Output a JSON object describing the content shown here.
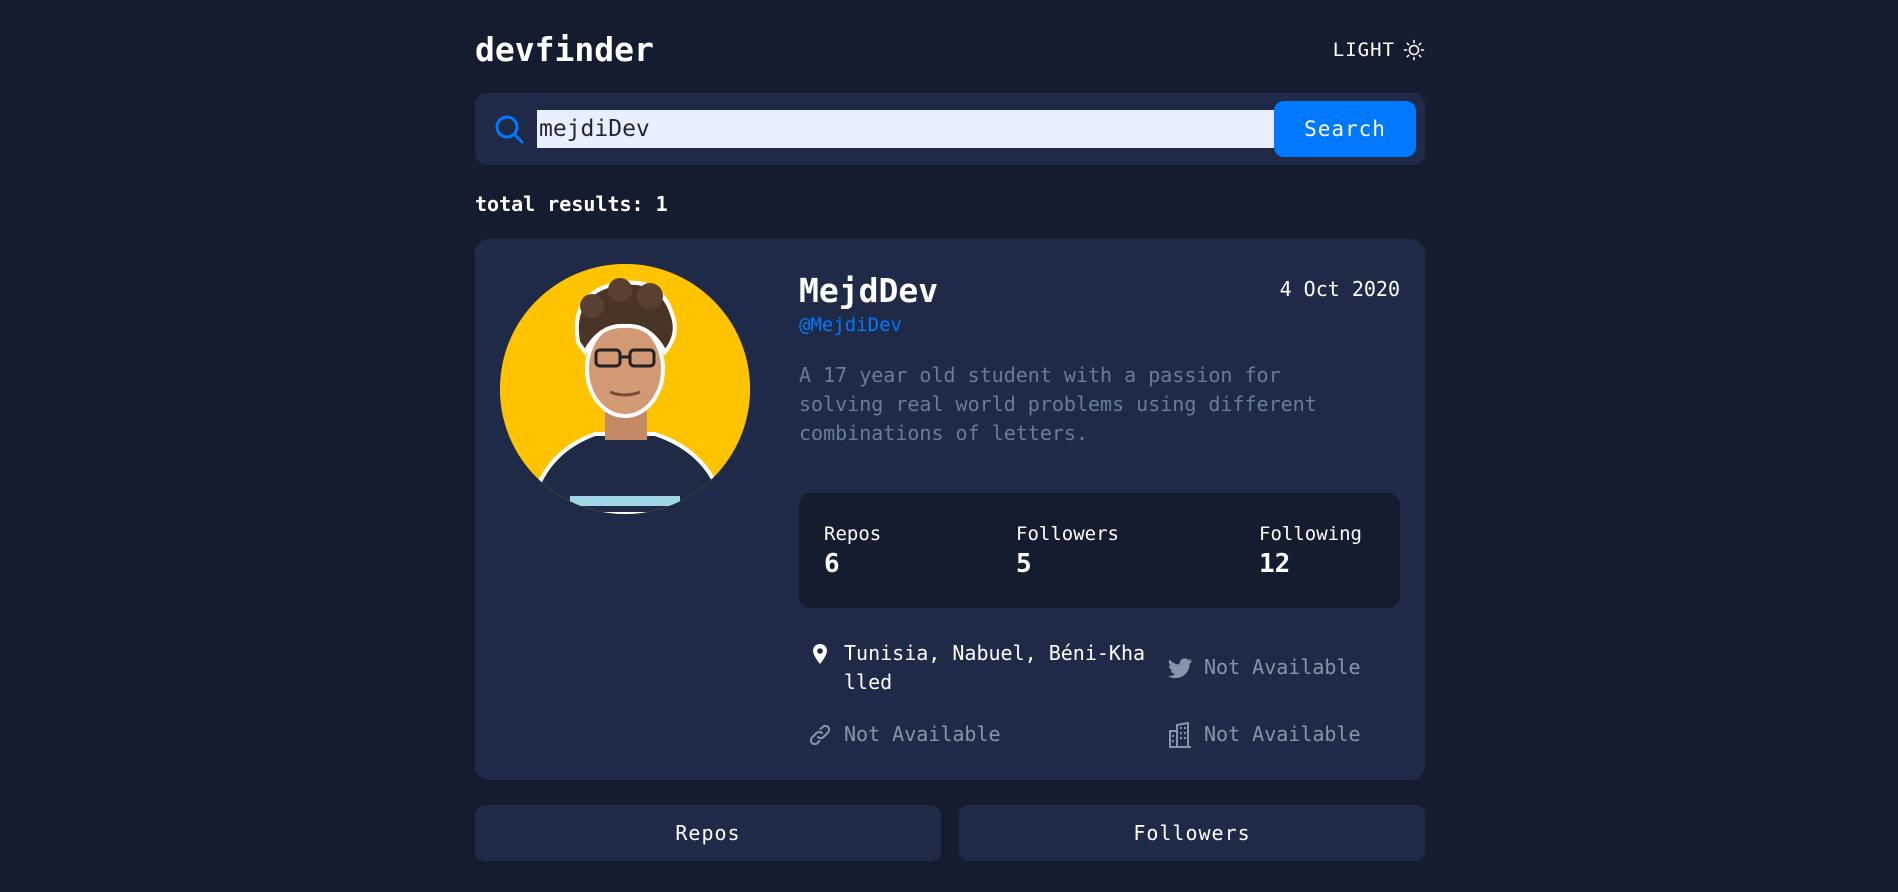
{
  "app": {
    "title": "devfinder",
    "theme_toggle_label": "LIGHT"
  },
  "search": {
    "value": "mejdiDev",
    "button_label": "Search"
  },
  "results": {
    "total_label": "total results: 1"
  },
  "profile": {
    "name": "MejdDev",
    "joined": "4 Oct 2020",
    "handle": "@MejdiDev",
    "bio": "A 17 year old student with a passion for solving real world problems using different combinations of letters.",
    "stats": {
      "repos_label": "Repos",
      "repos_value": "6",
      "followers_label": "Followers",
      "followers_value": "5",
      "following_label": "Following",
      "following_value": "12"
    },
    "location": "Tunisia, Nabuel, Béni-Khalled",
    "twitter": "Not Available",
    "website": "Not Available",
    "company": "Not Available"
  },
  "bottom_tabs": {
    "repos_label": "Repos",
    "followers_label": "Followers"
  },
  "colors": {
    "background": "#141d2f",
    "card": "#1e2a47",
    "accent": "#0079ff",
    "muted": "#697c9a",
    "avatar_bg": "#ffc300"
  }
}
